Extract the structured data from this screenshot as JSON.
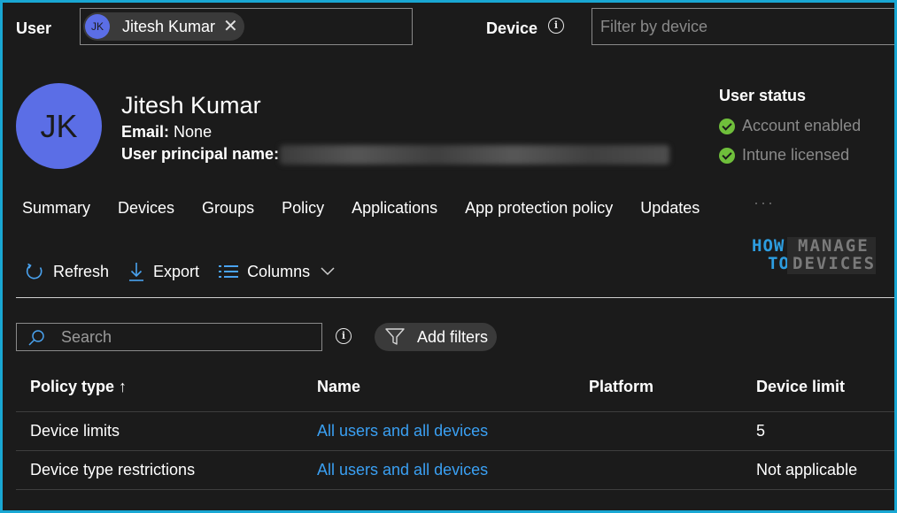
{
  "filters": {
    "user_label": "User",
    "user_chip_initials": "JK",
    "user_chip_name": "Jitesh Kumar",
    "user_chip_remove": "✕",
    "device_label": "Device",
    "device_placeholder": "Filter by device"
  },
  "profile": {
    "initials": "JK",
    "name": "Jitesh Kumar",
    "email_label": "Email:",
    "email_value": "None",
    "upn_label": "User principal name:"
  },
  "user_status": {
    "title": "User status",
    "items": [
      {
        "label": "Account enabled"
      },
      {
        "label": "Intune licensed"
      }
    ]
  },
  "tabs": [
    {
      "label": "Summary"
    },
    {
      "label": "Devices"
    },
    {
      "label": "Groups"
    },
    {
      "label": "Policy"
    },
    {
      "label": "Applications"
    },
    {
      "label": "App protection policy"
    },
    {
      "label": "Updates"
    }
  ],
  "tab_more": "···",
  "toolbar": {
    "refresh": "Refresh",
    "export": "Export",
    "columns": "Columns"
  },
  "logo": {
    "how_line1": "HOW",
    "how_line2": "TO",
    "manage": "MANAGE",
    "devices": "DEVICES"
  },
  "search": {
    "placeholder": "Search"
  },
  "add_filters": "Add filters",
  "table": {
    "headers": {
      "policy_type": "Policy type ↑",
      "name": "Name",
      "platform": "Platform",
      "device_limit": "Device limit"
    },
    "rows": [
      {
        "policy_type": "Device limits",
        "name": "All users and all devices",
        "platform": "",
        "device_limit": "5"
      },
      {
        "policy_type": "Device type restrictions",
        "name": "All users and all devices",
        "platform": "",
        "device_limit": "Not applicable"
      }
    ]
  },
  "colors": {
    "frame_border": "#19a7d3",
    "background": "#1b1b1b",
    "avatar": "#5b6ee6",
    "link": "#3aa0f3",
    "status_check": "#6fbf3b"
  }
}
